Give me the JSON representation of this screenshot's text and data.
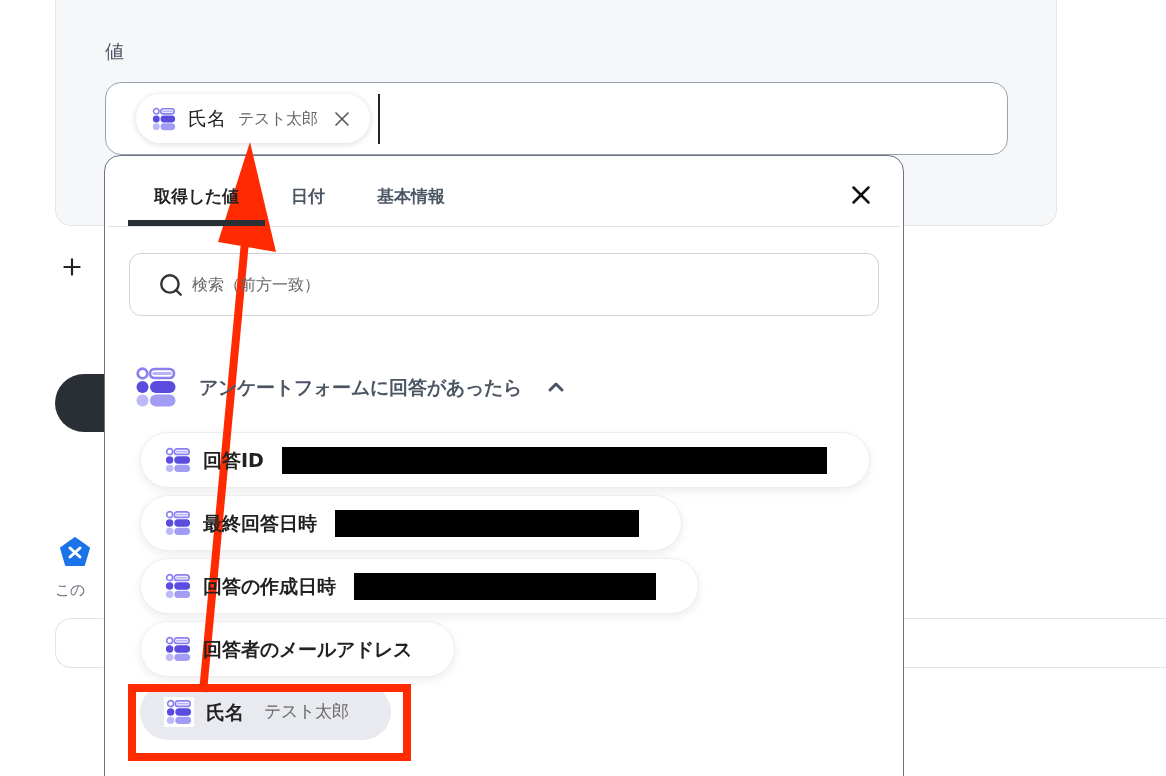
{
  "field": {
    "label": "値",
    "chip": {
      "name": "氏名",
      "value": "テスト太郎"
    }
  },
  "dropdown": {
    "tabs": [
      {
        "label": "取得した値",
        "selected": true
      },
      {
        "label": "日付",
        "selected": false
      },
      {
        "label": "基本情報",
        "selected": false
      }
    ],
    "search": {
      "placeholder": "検索（前方一致）"
    },
    "group": {
      "title": "アンケートフォームに回答があったら",
      "expanded": true,
      "items": [
        {
          "name": "回答ID",
          "redacted": true,
          "selected": false
        },
        {
          "name": "最終回答日時",
          "redacted": true,
          "selected": false
        },
        {
          "name": "回答の作成日時",
          "redacted": true,
          "selected": false
        },
        {
          "name": "回答者のメールアドレス",
          "redacted": false,
          "selected": false
        },
        {
          "name": "氏名",
          "value": "テスト太郎",
          "redacted": false,
          "selected": true
        }
      ]
    }
  },
  "behind": {
    "note": "この"
  }
}
